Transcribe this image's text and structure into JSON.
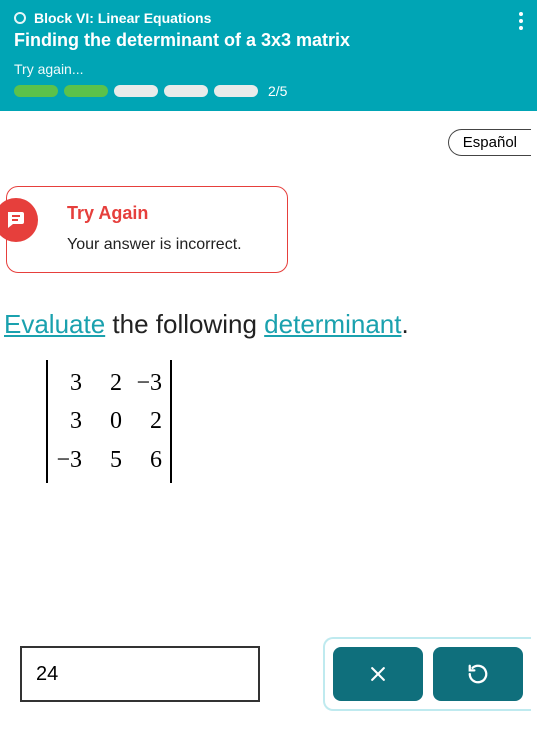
{
  "header": {
    "block_label": "Block VI: Linear Equations",
    "lesson_title": "Finding the determinant of a 3x3 matrix",
    "status_text": "Try again...",
    "progress": {
      "done": 2,
      "total": 5,
      "label": "2/5"
    }
  },
  "language_button": "Español",
  "feedback": {
    "title": "Try Again",
    "message": "Your answer is incorrect."
  },
  "prompt": {
    "link1": "Evaluate",
    "mid": " the following ",
    "link2": "determinant",
    "tail": "."
  },
  "matrix": {
    "r1": {
      "c1": "3",
      "c2": "2",
      "c3": "−3"
    },
    "r2": {
      "c1": "3",
      "c2": "0",
      "c3": "2"
    },
    "r3": {
      "c1": "−3",
      "c2": "5",
      "c3": "6"
    }
  },
  "answer_value": "24",
  "icons": {
    "close": "close-icon",
    "reset": "reset-icon",
    "feedback": "speech-lines-icon"
  }
}
